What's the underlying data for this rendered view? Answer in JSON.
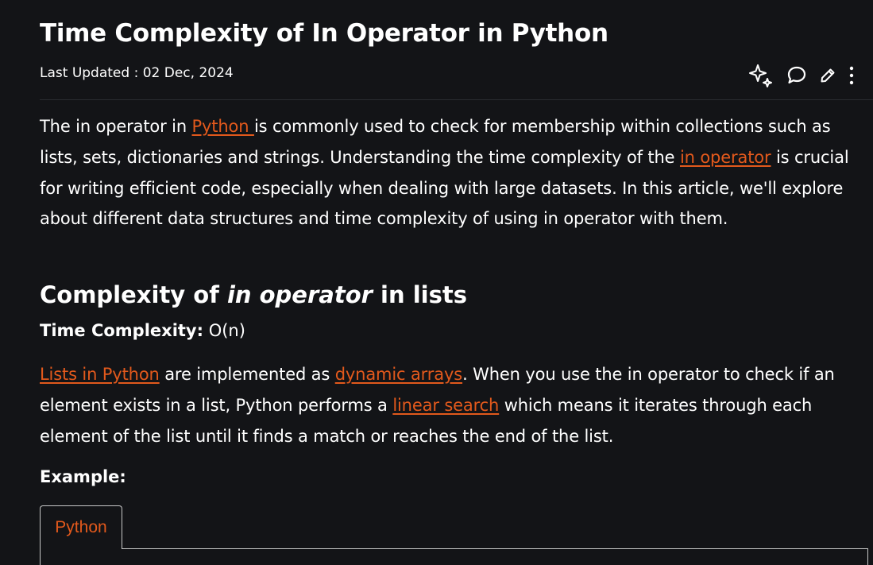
{
  "article": {
    "title": "Time Complexity of In Operator in Python",
    "last_updated": "Last Updated : 02 Dec, 2024"
  },
  "toolbar": {
    "icons": [
      "ai-sparkle-icon",
      "comment-icon",
      "edit-pencil-icon",
      "more-vertical-icon"
    ]
  },
  "intro": {
    "t1": "The in operator in ",
    "link_python": "Python ",
    "t2": "is commonly used to check for membership within collections such as lists, sets, dictionaries and strings. Understanding the time complexity of the ",
    "link_in_operator": "in operator",
    "t3": " is crucial for writing efficient code, especially when dealing with large datasets. In this article, we'll explore about different data structures and time complexity of using in operator with them."
  },
  "section_lists": {
    "heading_pre": "Complexity of ",
    "heading_em": "in operator",
    "heading_post": " in lists",
    "tc_label": "Time Complexity:",
    "tc_value": " O(n)",
    "link_lists": "Lists in Python",
    "t1": " are implemented as ",
    "link_dynamic_arrays": "dynamic arrays",
    "t2": ". When you use the in operator to check if an element exists in a list, Python performs a ",
    "link_linear_search": "linear search",
    "t3": " which means it iterates through each element of the list until it finds a match or reaches the end of the list.",
    "example_label": "Example:",
    "code_tab": "Python"
  },
  "colors": {
    "background": "#131417",
    "text": "#ffffff",
    "link": "#e2591c",
    "border": "#c8c8c8"
  }
}
